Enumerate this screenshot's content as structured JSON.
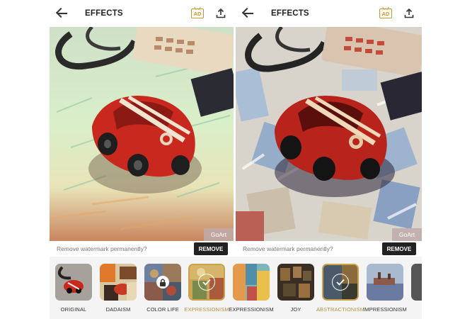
{
  "left_screen": {
    "title": "EFFECTS",
    "watermark": "GoArt",
    "remove_prompt": "Remove watermark permanently?",
    "remove_label": "REMOVE"
  },
  "right_screen": {
    "title": "EFFECTS",
    "watermark": "GoArt",
    "remove_prompt": "Remove watermark permanently?",
    "remove_label": "REMOVE"
  },
  "header": {
    "ad_icon_text": "AD"
  },
  "effects": [
    {
      "label": "ORIGINAL",
      "selected": false,
      "locked": false
    },
    {
      "label": "DADAISM",
      "selected": false,
      "locked": false
    },
    {
      "label": "COLOR LIFE",
      "selected": false,
      "locked": true
    },
    {
      "label": "EXPRESSIONISM",
      "selected": true,
      "locked": false
    },
    {
      "label": "EXPRESSIONISM",
      "selected": false,
      "locked": false
    },
    {
      "label": "JOY",
      "selected": false,
      "locked": false
    },
    {
      "label": "ABSTRACTIONISM",
      "selected": true,
      "locked": false
    },
    {
      "label": "IMPRESSIONISM",
      "selected": false,
      "locked": false
    }
  ],
  "colors": {
    "accent": "#c9a24a",
    "button_bg": "#222222",
    "car_red": "#c8281e"
  },
  "icons": {
    "back": "back-arrow-icon",
    "ad": "ad-tv-icon",
    "share": "share-upload-icon",
    "lock": "lock-icon",
    "check": "check-icon"
  }
}
